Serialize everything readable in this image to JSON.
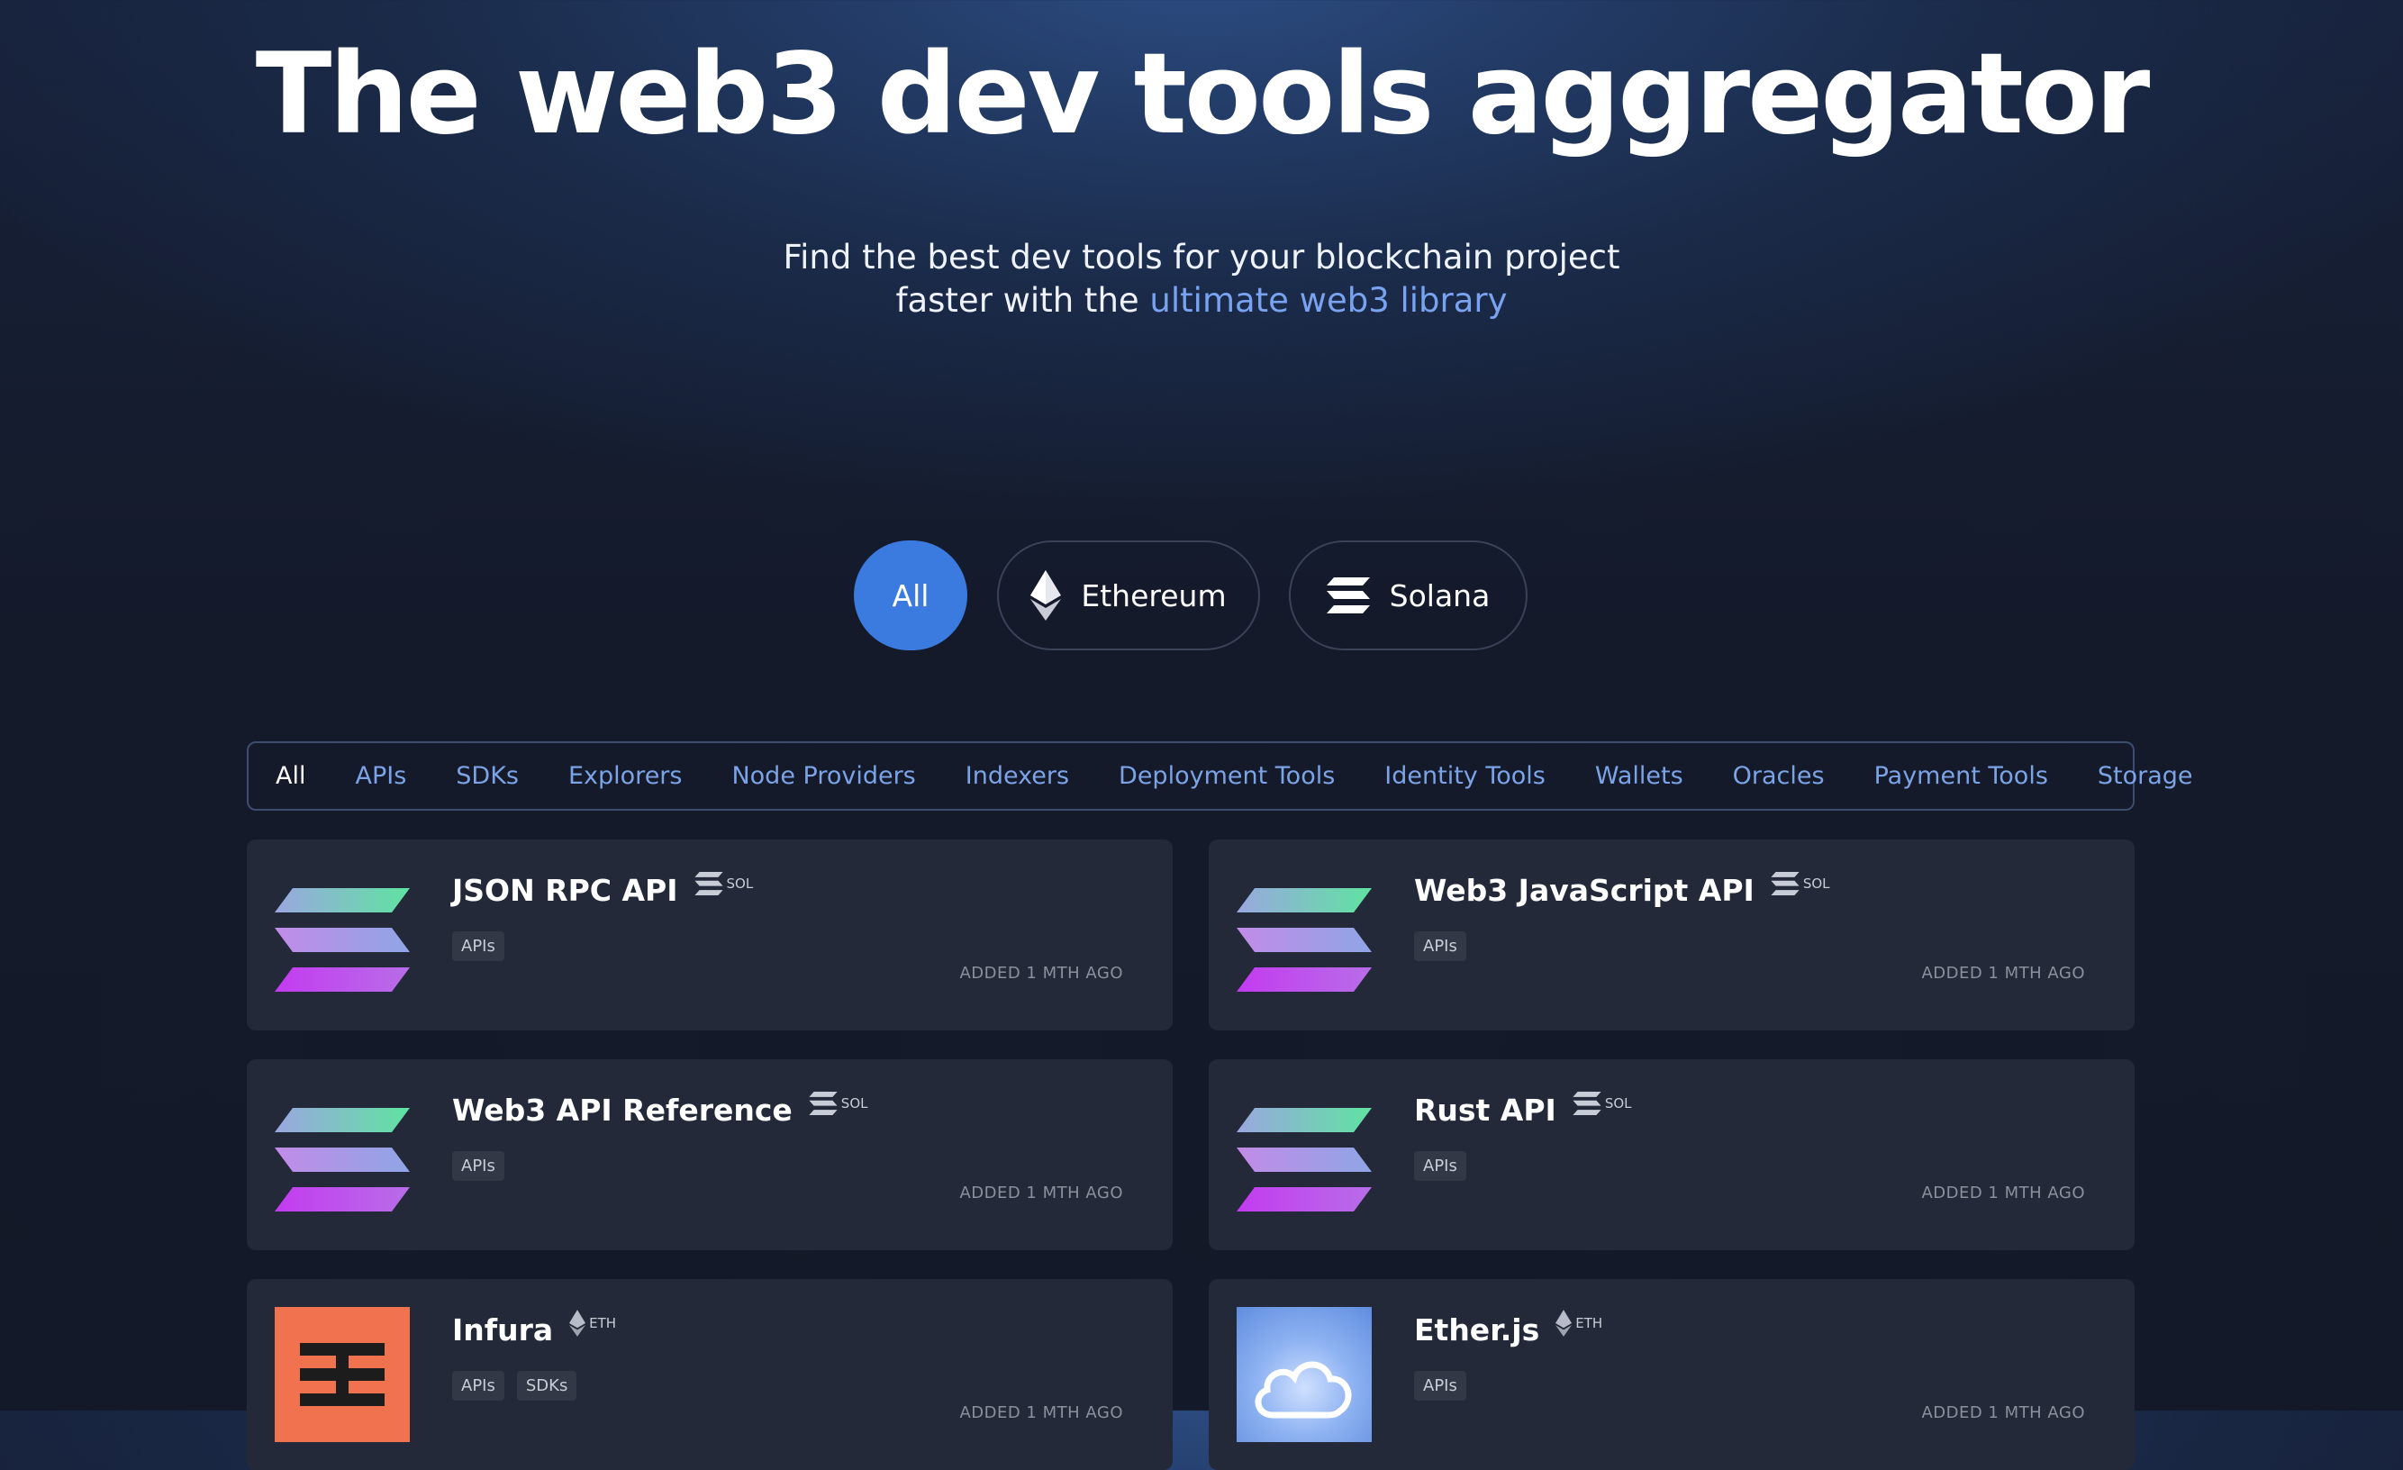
{
  "hero": {
    "title": "The web3 dev tools aggregator",
    "subtitle_line1": "Find the best dev tools for your blockchain project",
    "subtitle_line2_prefix": "faster with the ",
    "subtitle_line2_link": "ultimate web3 library"
  },
  "chain_filter": {
    "selected": "All",
    "options": [
      {
        "label": "All",
        "icon": "none"
      },
      {
        "label": "Ethereum",
        "icon": "ethereum-icon"
      },
      {
        "label": "Solana",
        "icon": "solana-icon"
      }
    ]
  },
  "categories": {
    "selected": "All",
    "items": [
      "All",
      "APIs",
      "SDKs",
      "Explorers",
      "Node Providers",
      "Indexers",
      "Deployment Tools",
      "Identity Tools",
      "Wallets",
      "Oracles",
      "Payment Tools",
      "Storage"
    ]
  },
  "tools": [
    {
      "name": "JSON RPC API",
      "chain": "SOL",
      "chain_icon": "solana-icon",
      "logo": "solana-logo",
      "tags": [
        "APIs"
      ],
      "added": "ADDED 1 MTH AGO"
    },
    {
      "name": "Web3 JavaScript API",
      "chain": "SOL",
      "chain_icon": "solana-icon",
      "logo": "solana-logo",
      "tags": [
        "APIs"
      ],
      "added": "ADDED 1 MTH AGO"
    },
    {
      "name": "Web3 API Reference",
      "chain": "SOL",
      "chain_icon": "solana-icon",
      "logo": "solana-logo",
      "tags": [
        "APIs"
      ],
      "added": "ADDED 1 MTH AGO"
    },
    {
      "name": "Rust API",
      "chain": "SOL",
      "chain_icon": "solana-icon",
      "logo": "solana-logo",
      "tags": [
        "APIs"
      ],
      "added": "ADDED 1 MTH AGO"
    },
    {
      "name": "Infura",
      "chain": "ETH",
      "chain_icon": "ethereum-icon",
      "logo": "infura-logo",
      "tags": [
        "APIs",
        "SDKs"
      ],
      "added": "ADDED 1 MTH AGO"
    },
    {
      "name": "Ether.js",
      "chain": "ETH",
      "chain_icon": "ethereum-icon",
      "logo": "etherjs-logo",
      "tags": [
        "APIs"
      ],
      "added": "ADDED 1 MTH AGO"
    }
  ],
  "colors": {
    "accent": "#3b7be0",
    "link": "#79a3f0",
    "category_text": "#7ba3e6",
    "card_bg": "#232938",
    "page_bg": "#141a2a",
    "infura_orange": "#f0724f"
  }
}
